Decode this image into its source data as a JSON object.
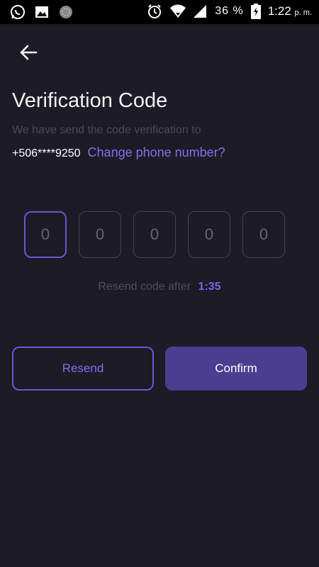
{
  "status_bar": {
    "battery_percent": "36 %",
    "time": "1:22",
    "time_suffix": "p. m.",
    "icons": [
      "whatsapp-icon",
      "gallery-icon",
      "sync-icon",
      "alarm-icon",
      "wifi-icon",
      "signal-icon",
      "battery-charging-icon"
    ]
  },
  "header": {
    "back_icon": "arrow-left-icon"
  },
  "main": {
    "title": "Verification Code",
    "subtitle": "We have send the code verification to",
    "phone_number": "+506****9250",
    "change_link": "Change phone number?",
    "code_digits": [
      "0",
      "0",
      "0",
      "0",
      "0"
    ],
    "resend_label": "Resend code after",
    "resend_timer": "1:35"
  },
  "actions": {
    "resend_label": "Resend",
    "confirm_label": "Confirm"
  },
  "colors": {
    "background": "#1c1b26",
    "accent": "#6d55d6",
    "accent_text": "#8a6cf0",
    "confirm_fill": "#4b3d8f"
  }
}
